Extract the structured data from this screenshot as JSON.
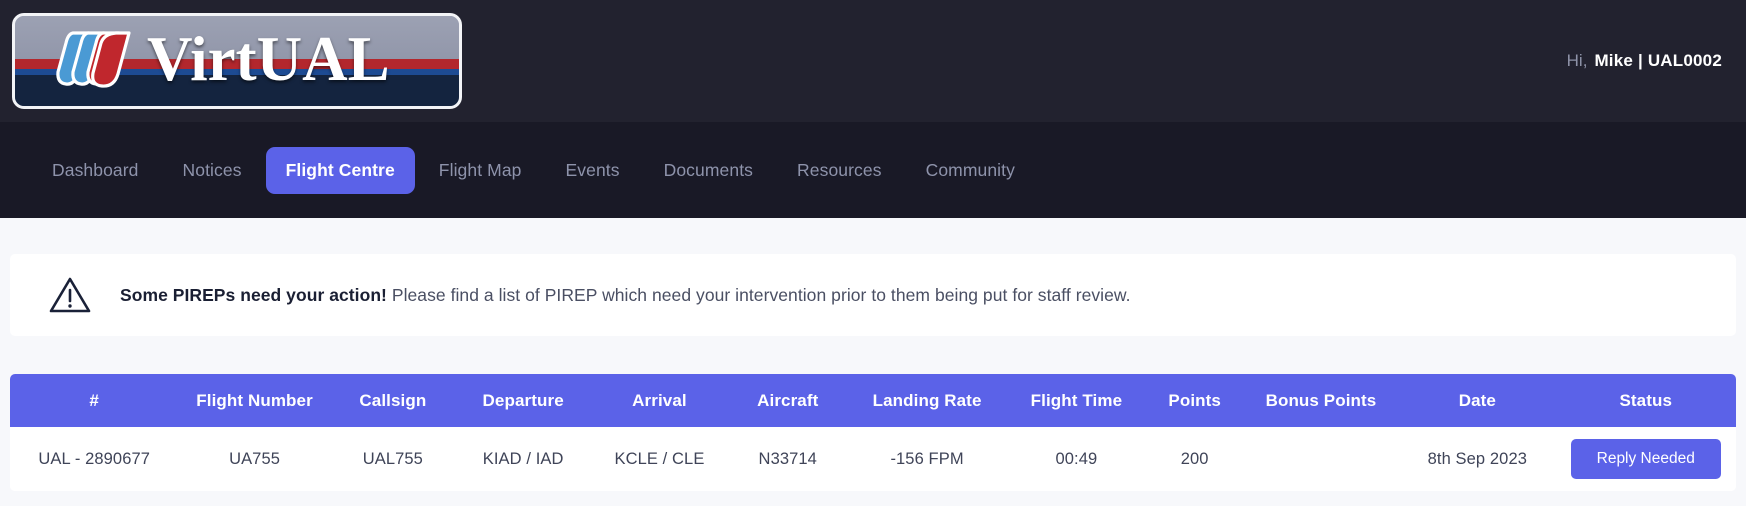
{
  "header": {
    "logo": {
      "wordmark": "VirtUAL",
      "icon": "united-tulip-icon",
      "colors": {
        "gray": "#9ca1b3",
        "red": "#b3272d",
        "blue": "#1d4b93",
        "navy": "#14243f"
      }
    },
    "greeting": {
      "prefix": "Hi,",
      "user": "Mike | UAL0002"
    },
    "background": "#22222f"
  },
  "nav": {
    "background": "#191926",
    "active_color": "#5b62e8",
    "items": [
      {
        "label": "Dashboard",
        "active": false
      },
      {
        "label": "Notices",
        "active": false
      },
      {
        "label": "Flight Centre",
        "active": true
      },
      {
        "label": "Flight Map",
        "active": false
      },
      {
        "label": "Events",
        "active": false
      },
      {
        "label": "Documents",
        "active": false
      },
      {
        "label": "Resources",
        "active": false
      },
      {
        "label": "Community",
        "active": false
      }
    ]
  },
  "alert": {
    "icon": "warning-triangle-icon",
    "title": "Some PIREPs need your action!",
    "message": "Please find a list of PIREP which need your intervention prior to them being put for staff review."
  },
  "table": {
    "header_background": "#5b62e8",
    "columns": [
      "#",
      "Flight Number",
      "Callsign",
      "Departure",
      "Arrival",
      "Aircraft",
      "Landing Rate",
      "Flight Time",
      "Points",
      "Bonus Points",
      "Date",
      "Status"
    ],
    "rows": [
      {
        "id": "UAL - 2890677",
        "flight_number": "UA755",
        "callsign": "UAL755",
        "departure": "KIAD / IAD",
        "arrival": "KCLE / CLE",
        "aircraft": "N33714",
        "landing_rate": "-156 FPM",
        "flight_time": "00:49",
        "points": "200",
        "bonus_points": "",
        "date": "8th Sep 2023",
        "status": "Reply Needed"
      }
    ]
  }
}
